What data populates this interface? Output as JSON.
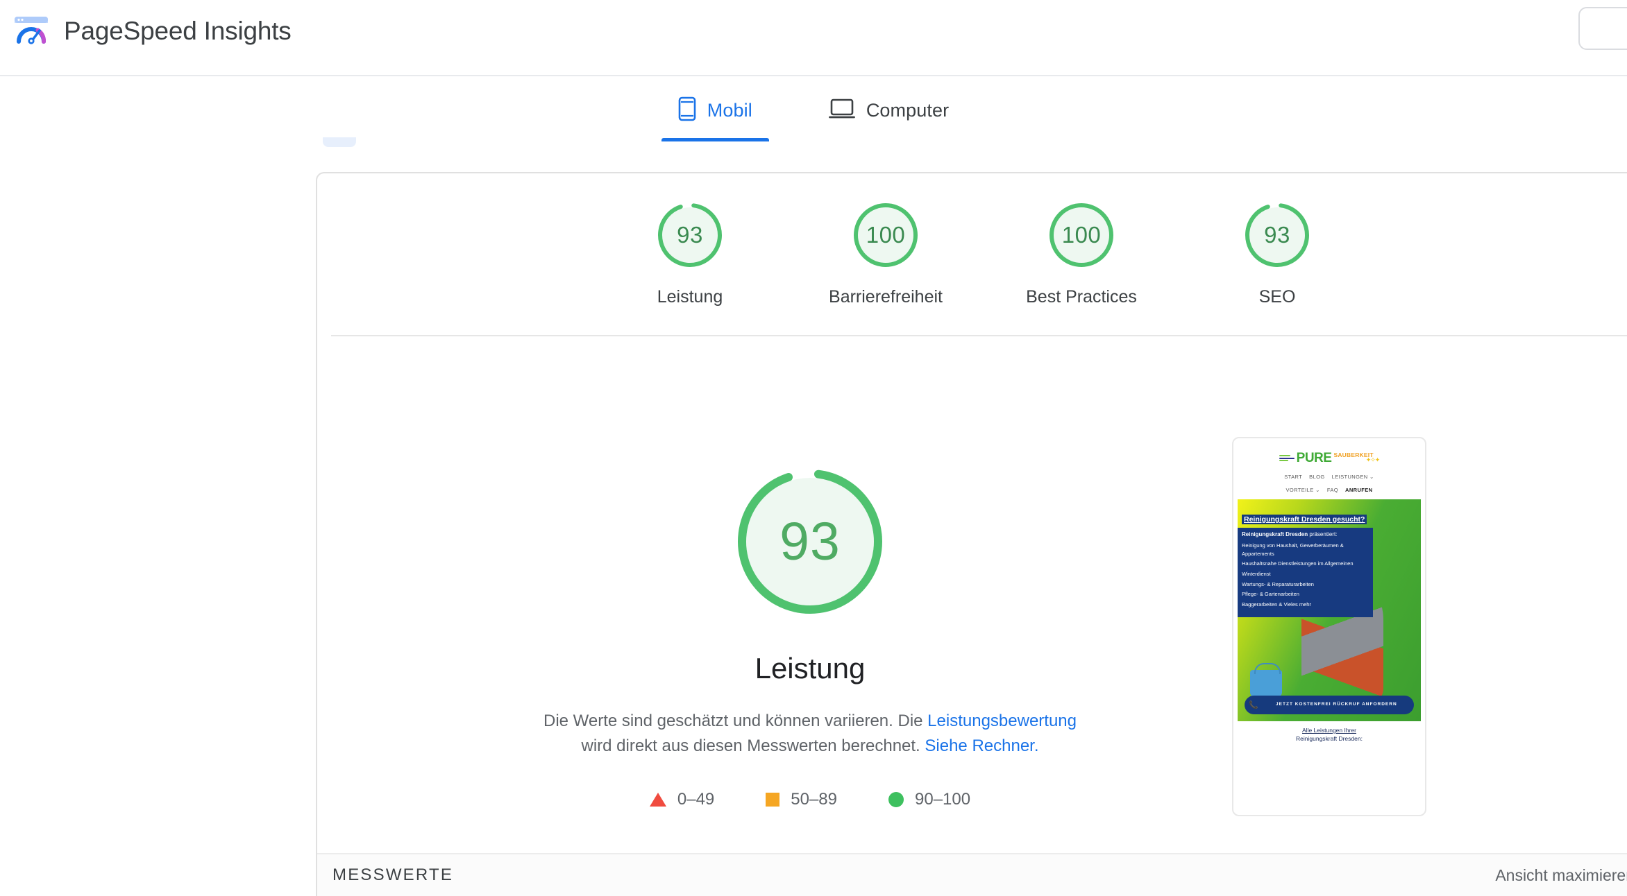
{
  "app": {
    "title": "PageSpeed Insights",
    "logo_icon": "pagespeed-gauge-logo"
  },
  "tabs": [
    {
      "label": "Mobil",
      "icon": "phone-icon",
      "active": true
    },
    {
      "label": "Computer",
      "icon": "laptop-icon",
      "active": false
    }
  ],
  "category_scores": [
    {
      "label": "Leistung",
      "value": "93"
    },
    {
      "label": "Barrierefreiheit",
      "value": "100"
    },
    {
      "label": "Best Practices",
      "value": "100"
    },
    {
      "label": "SEO",
      "value": "93"
    }
  ],
  "main_score": {
    "value": "93",
    "title": "Leistung",
    "desc_part1": "Die Werte sind geschätzt und können variieren. Die ",
    "link1": "Leistungsbewertung",
    "desc_part2": " wird direkt aus diesen Messwerten berechnet. ",
    "link2": "Siehe Rechner."
  },
  "legend": [
    {
      "shape": "triangle",
      "range": "0–49",
      "color": "#f04b3f"
    },
    {
      "shape": "square",
      "range": "50–89",
      "color": "#f5a623"
    },
    {
      "shape": "circle",
      "range": "90–100",
      "color": "#3ec05f"
    }
  ],
  "bottom_bar": {
    "section_label": "MESSWERTE",
    "maximize_label": "Ansicht maximieren"
  },
  "thumbnail": {
    "logo_main": "PURE",
    "logo_sub": "SAUBERKEIT",
    "nav_row1": [
      "START",
      "BLOG",
      "LEISTUNGEN ⌄"
    ],
    "nav_row2": [
      "VORTEILE ⌄",
      "FAQ"
    ],
    "nav_row2_bold": "ANRUFEN",
    "headline": "Reinigungskraft Dresden gesucht?",
    "lead_bold": "Reinigungskraft Dresden",
    "lead_rest": " präsentiert:",
    "services": [
      "Reinigung von Haushalt, Gewerberäumen & Appartements",
      "Haushaltsnahe Dienstleistungen im Allgemeinen",
      "Winterdienst",
      "Wartungs- & Reparaturarbeiten",
      "Pflege- & Gartenarbeiten",
      "Baggerarbeiten & Vieles mehr"
    ],
    "cta": "JETZT KOSTENFREI RÜCKRUF ANFORDERN",
    "cta_icon": "phone-icon",
    "footer_link": "Alle Leistungen Ihrer",
    "footer_text": "Reinigungskraft Dresden:"
  },
  "colors": {
    "accent_blue": "#1a73e8",
    "score_green": "#4fc26f",
    "score_green_fill": "#eef8f1",
    "text_primary": "#202124",
    "text_secondary": "#5f6368"
  }
}
